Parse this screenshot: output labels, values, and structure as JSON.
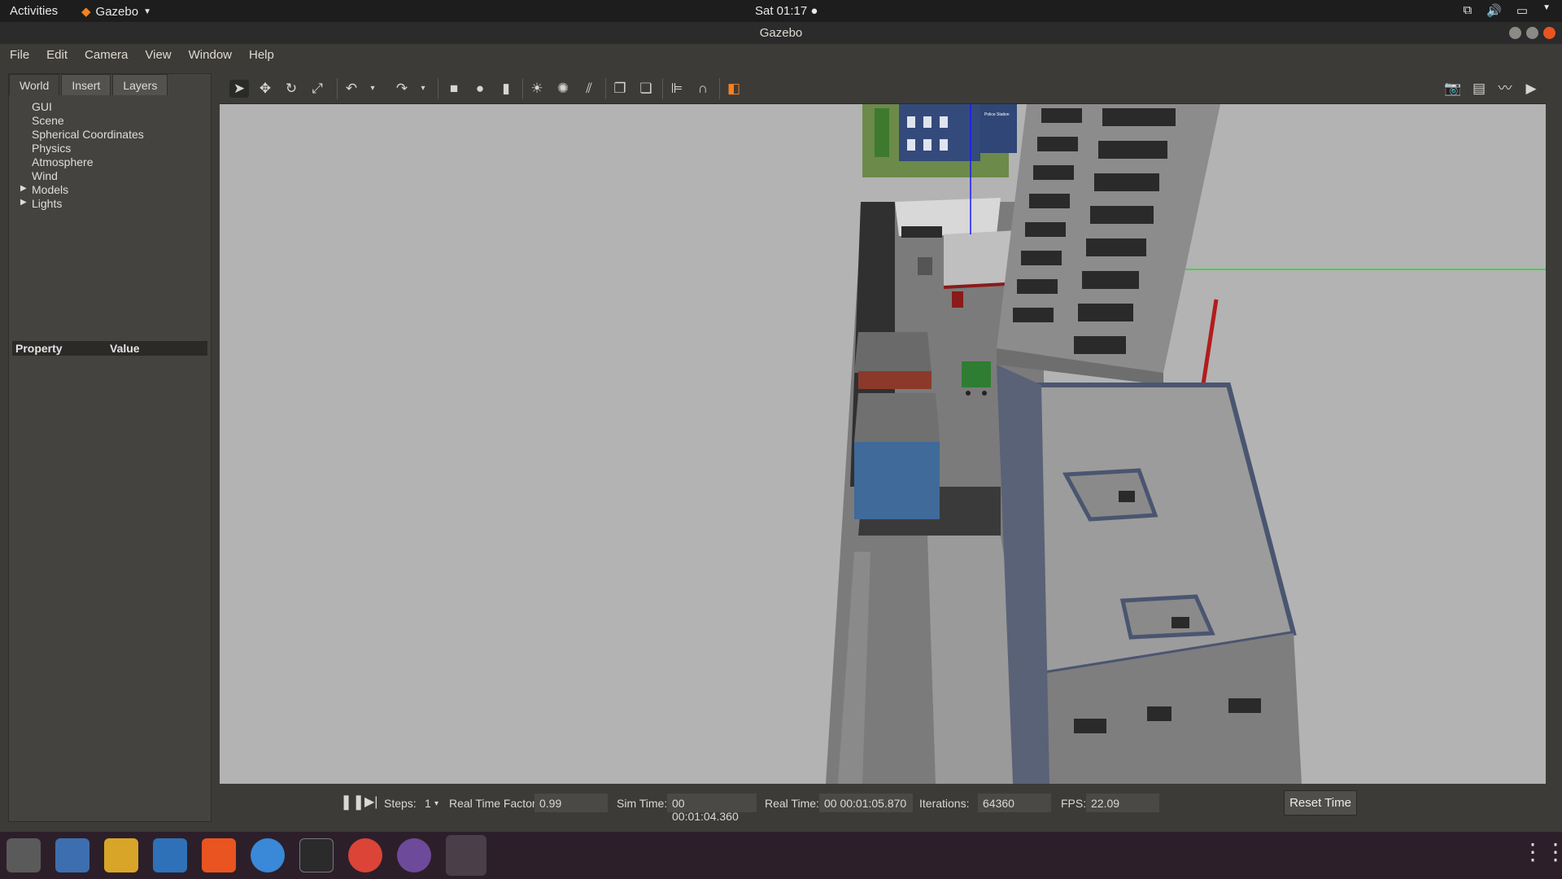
{
  "topbar": {
    "activities": "Activities",
    "app_name": "Gazebo",
    "clock": "Sat 01:17"
  },
  "window": {
    "title": "Gazebo"
  },
  "menubar": [
    "File",
    "Edit",
    "Camera",
    "View",
    "Window",
    "Help"
  ],
  "left_panel": {
    "tabs": [
      "World",
      "Insert",
      "Layers"
    ],
    "active_tab": "World",
    "tree": [
      {
        "label": "GUI",
        "expandable": false
      },
      {
        "label": "Scene",
        "expandable": false
      },
      {
        "label": "Spherical Coordinates",
        "expandable": false
      },
      {
        "label": "Physics",
        "expandable": false
      },
      {
        "label": "Atmosphere",
        "expandable": false
      },
      {
        "label": "Wind",
        "expandable": false
      },
      {
        "label": "Models",
        "expandable": true
      },
      {
        "label": "Lights",
        "expandable": true
      }
    ],
    "property_header": "Property",
    "value_header": "Value"
  },
  "toolbar": {
    "tools": [
      "select-arrow-icon",
      "translate-icon",
      "rotate-icon",
      "scale-icon",
      "undo-icon",
      "redo-icon",
      "box-icon",
      "sphere-icon",
      "cylinder-icon",
      "point-light-icon",
      "spot-light-icon",
      "directional-light-icon",
      "copy-icon",
      "paste-icon",
      "align-icon",
      "snap-icon",
      "view-angle-icon"
    ],
    "right_tools": [
      "screenshot-icon",
      "log-icon",
      "plot-icon",
      "video-icon"
    ]
  },
  "bottombar": {
    "steps_label": "Steps:",
    "steps_value": "1",
    "rtf_label": "Real Time Factor:",
    "rtf_value": "0.99",
    "sim_time_label": "Sim Time:",
    "sim_time_value": "00 00:01:04.360",
    "real_time_label": "Real Time:",
    "real_time_value": "00 00:01:05.870",
    "iterations_label": "Iterations:",
    "iterations_value": "64360",
    "fps_label": "FPS:",
    "fps_value": "22.09",
    "reset_label": "Reset Time"
  },
  "scene": {
    "sign_text": "Police Station"
  },
  "dock": [
    "files-icon",
    "thunderbird-icon",
    "rhythmbox-icon",
    "writer-icon",
    "software-icon",
    "help-icon",
    "terminal-icon",
    "chrome-icon",
    "github-icon",
    "gazebo-icon"
  ]
}
